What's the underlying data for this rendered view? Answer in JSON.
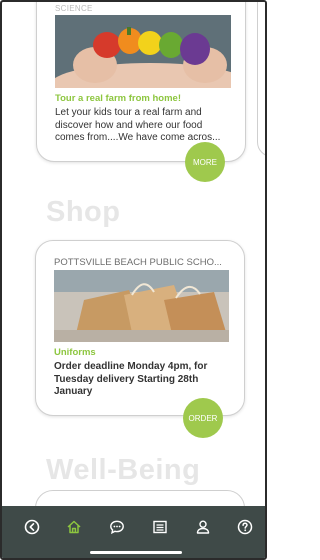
{
  "feed": {
    "top_card": {
      "eyebrow": "SCIENCE",
      "title": "Tour a real farm from home!",
      "description": "Let your kids tour a real farm and discover how and where our food comes from....We have come acros...",
      "more_label": "MORE"
    },
    "sections": [
      {
        "heading": "Shop"
      },
      {
        "heading": "Well-Being"
      }
    ],
    "shop_card": {
      "school": "POTTSVILLE BEACH PUBLIC SCHO...",
      "title": "Uniforms",
      "description": "Order deadline Monday 4pm, for Tuesday delivery Starting 28th January",
      "order_label": "ORDER"
    }
  },
  "bottom_nav": {
    "items": [
      {
        "icon": "back-arrow-icon"
      },
      {
        "icon": "home-icon",
        "active": true
      },
      {
        "icon": "chat-icon"
      },
      {
        "icon": "list-icon"
      },
      {
        "icon": "profile-icon"
      },
      {
        "icon": "help-icon"
      }
    ]
  },
  "colors": {
    "accent": "#8dc63f",
    "button": "#9fc94d",
    "nav_bg": "#3f4a48",
    "heading_faded": "#e6e6e6"
  }
}
